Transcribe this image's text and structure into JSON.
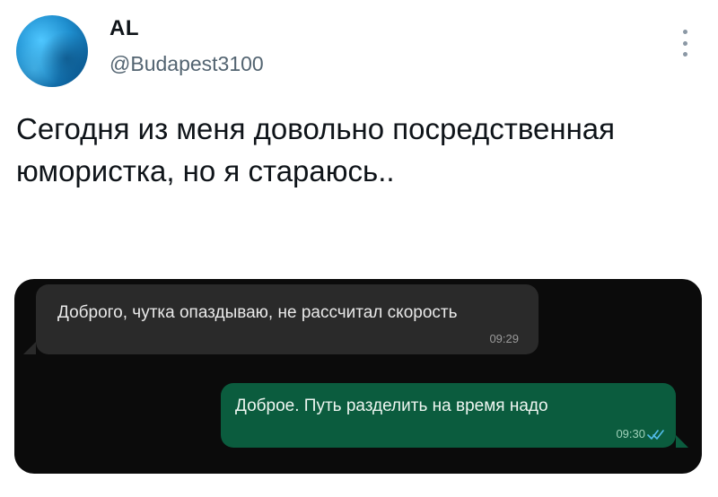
{
  "tweet": {
    "display_name": "AL",
    "handle": "@Budapest3100",
    "text": "Сегодня из меня довольно посредственная юмористка, но я стараюсь.."
  },
  "chat": {
    "incoming": {
      "text": "Доброго, чутка опаздываю, не рассчитал скорость",
      "time": "09:29"
    },
    "outgoing": {
      "text": "Доброе. Путь разделить на время надо",
      "time": "09:30",
      "status_icon": "double-check-icon"
    }
  },
  "colors": {
    "chat_background": "#0b0b0b",
    "incoming_bubble": "#2a2a2a",
    "outgoing_bubble": "#0b5c3e",
    "read_check": "#53bdeb"
  }
}
